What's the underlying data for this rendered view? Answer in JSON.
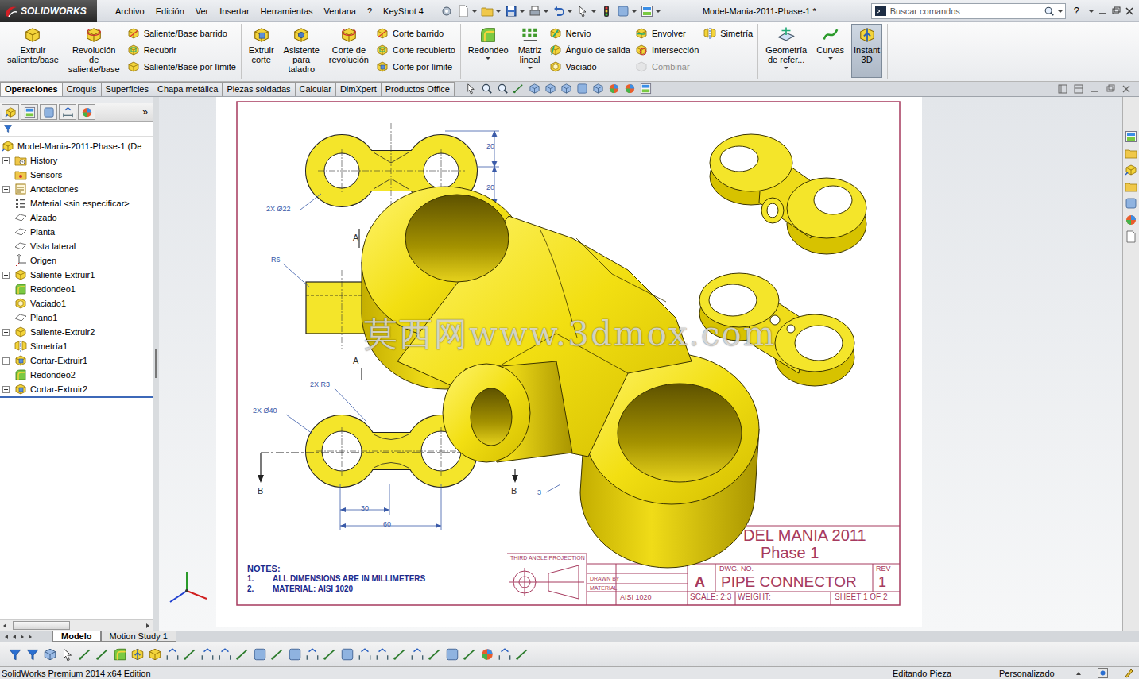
{
  "app": {
    "logo": "SOLIDWORKS"
  },
  "menu": [
    "Archivo",
    "Edición",
    "Ver",
    "Insertar",
    "Herramientas",
    "Ventana",
    "?",
    "KeyShot 4"
  ],
  "window": {
    "title": "Model-Mania-2011-Phase-1 *"
  },
  "search": {
    "placeholder": "Buscar comandos"
  },
  "help": "?",
  "ribbon": {
    "groups": [
      [
        {
          "kind": "large",
          "label": "Extruir saliente/base",
          "selected": false,
          "has_menu": false
        },
        {
          "kind": "large",
          "label": "Revolución de saliente/base",
          "selected": false,
          "has_menu": false
        },
        {
          "kind": "column",
          "items": [
            {
              "label": "Saliente/Base barrido",
              "disabled": false
            },
            {
              "label": "Recubrir",
              "disabled": false
            },
            {
              "label": "Saliente/Base por límite",
              "disabled": false
            }
          ]
        }
      ],
      [
        {
          "kind": "large",
          "label": "Extruir corte",
          "selected": false,
          "has_menu": false
        },
        {
          "kind": "large",
          "label": "Asistente para taladro",
          "selected": false,
          "has_menu": false
        },
        {
          "kind": "large",
          "label": "Corte de revolución",
          "selected": false,
          "has_menu": false
        },
        {
          "kind": "column",
          "items": [
            {
              "label": "Corte barrido",
              "disabled": false
            },
            {
              "label": "Corte recubierto",
              "disabled": false
            },
            {
              "label": "Corte por límite",
              "disabled": false
            }
          ]
        }
      ],
      [
        {
          "kind": "large",
          "label": "Redondeo",
          "selected": false,
          "has_menu": true
        },
        {
          "kind": "large",
          "label": "Matriz lineal",
          "selected": false,
          "has_menu": true
        },
        {
          "kind": "column",
          "items": [
            {
              "label": "Nervio",
              "disabled": false
            },
            {
              "label": "Ángulo de salida",
              "disabled": false
            },
            {
              "label": "Vaciado",
              "disabled": false
            }
          ]
        },
        {
          "kind": "column",
          "items": [
            {
              "label": "Envolver",
              "disabled": false
            },
            {
              "label": "Intersección",
              "disabled": false
            },
            {
              "label": "Combinar",
              "disabled": true
            }
          ]
        },
        {
          "kind": "column",
          "items": [
            {
              "label": "Simetría",
              "disabled": false
            }
          ]
        }
      ],
      [
        {
          "kind": "large",
          "label": "Geometría de refer...",
          "selected": false,
          "has_menu": true
        },
        {
          "kind": "large",
          "label": "Curvas",
          "selected": false,
          "has_menu": true
        },
        {
          "kind": "large",
          "label": "Instant 3D",
          "selected": true,
          "has_menu": false
        }
      ]
    ]
  },
  "tabs": [
    {
      "label": "Operaciones",
      "selected": true
    },
    {
      "label": "Croquis",
      "selected": false
    },
    {
      "label": "Superficies",
      "selected": false
    },
    {
      "label": "Chapa metálica",
      "selected": false
    },
    {
      "label": "Piezas soldadas",
      "selected": false
    },
    {
      "label": "Calcular",
      "selected": false
    },
    {
      "label": "DimXpert",
      "selected": false
    },
    {
      "label": "Productos Office",
      "selected": false
    }
  ],
  "left_panel": {
    "more": "»"
  },
  "tree": {
    "root": "Model-Mania-2011-Phase-1  (De",
    "items": [
      {
        "label": "History",
        "kind": "history",
        "expandable": true
      },
      {
        "label": "Sensors",
        "kind": "sensor",
        "expandable": false
      },
      {
        "label": "Anotaciones",
        "kind": "annotation",
        "expandable": true
      },
      {
        "label": "Material <sin especificar>",
        "kind": "material",
        "expandable": false
      },
      {
        "label": "Alzado",
        "kind": "plane",
        "expandable": false
      },
      {
        "label": "Planta",
        "kind": "plane",
        "expandable": false
      },
      {
        "label": "Vista lateral",
        "kind": "plane",
        "expandable": false
      },
      {
        "label": "Origen",
        "kind": "origin",
        "expandable": false
      },
      {
        "label": "Saliente-Extruir1",
        "kind": "extrude",
        "expandable": true
      },
      {
        "label": "Redondeo1",
        "kind": "fillet",
        "expandable": false
      },
      {
        "label": "Vaciado1",
        "kind": "shell",
        "expandable": false
      },
      {
        "label": "Plano1",
        "kind": "plane",
        "expandable": false
      },
      {
        "label": "Saliente-Extruir2",
        "kind": "extrude",
        "expandable": true
      },
      {
        "label": "Simetría1",
        "kind": "mirror",
        "expandable": false
      },
      {
        "label": "Cortar-Extruir1",
        "kind": "cut",
        "expandable": true
      },
      {
        "label": "Redondeo2",
        "kind": "fillet",
        "expandable": false
      },
      {
        "label": "Cortar-Extruir2",
        "kind": "cut",
        "expandable": true
      }
    ]
  },
  "drawing": {
    "dimensions": [
      "20",
      "20",
      "2X Ø22",
      "R6",
      "2X R3",
      "2X Ø40",
      "30",
      "60",
      "3"
    ],
    "section_labels": [
      "A",
      "A",
      "B",
      "B"
    ],
    "notes": {
      "title": "NOTES:",
      "items": [
        {
          "number": "1.",
          "text": "ALL DIMENSIONS ARE IN MILLIMETERS"
        },
        {
          "number": "2.",
          "text": "MATERIAL: AISI 1020"
        }
      ]
    },
    "projection_label": "THIRD ANGLE PROJECTION",
    "title_block": {
      "title_line1": "DEL MANIA 2011",
      "title_line2": "Phase 1",
      "drawn_by_label": "DRAWN BY",
      "material_label": "MATERIAL",
      "material": "AISI 1020",
      "size": "A",
      "dwg_no_label": "DWG. NO.",
      "dwg_name": "PIPE CONNECTOR",
      "rev_label": "REV",
      "rev": "1",
      "scale": "SCALE: 2:3",
      "weight": "WEIGHT:",
      "sheet": "SHEET 1 OF 2"
    },
    "watermark": "莫西网www.3dmox.com"
  },
  "bottom_tabs": [
    {
      "label": "Modelo",
      "selected": true
    },
    {
      "label": "Motion Study 1",
      "selected": false
    }
  ],
  "status_bar": {
    "edition": "SolidWorks Premium 2014 x64 Edition",
    "mode": "Editando Pieza",
    "units": "Personalizado"
  }
}
